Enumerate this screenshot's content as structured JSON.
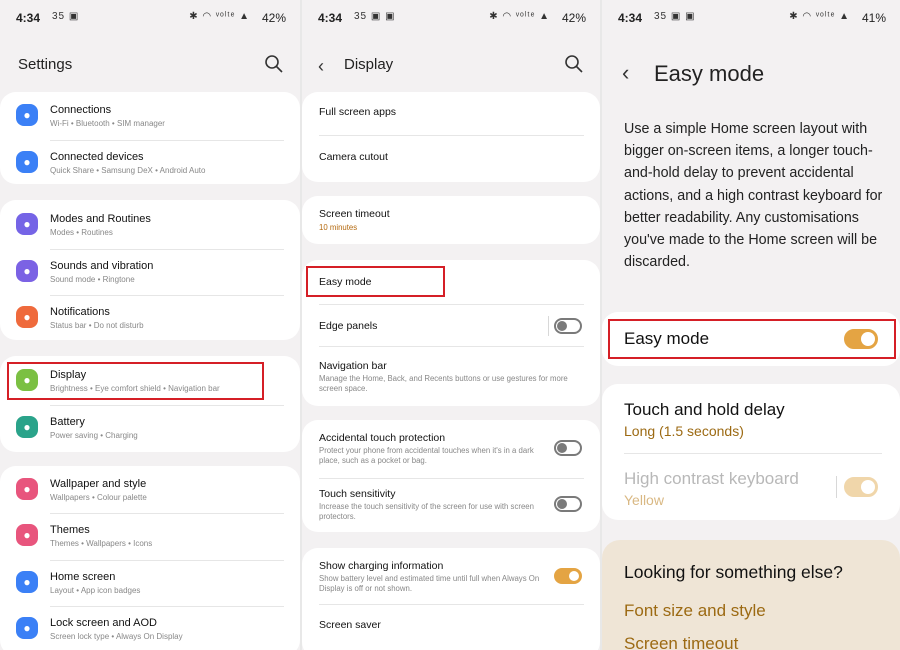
{
  "p1": {
    "status": {
      "time": "4:34",
      "icons_left": "35 ▣",
      "icons_right": "✱ ◠ ᵛᵒˡᵗᵉ ▲",
      "battery": "42%"
    },
    "title": "Settings",
    "items": [
      {
        "label": "Connections",
        "sub": "Wi-Fi • Bluetooth • SIM manager",
        "icon": "wifi-icon",
        "color": "#3b80f6"
      },
      {
        "label": "Connected devices",
        "sub": "Quick Share • Samsung DeX • Android Auto",
        "icon": "devices-icon",
        "color": "#3b80f6"
      },
      {
        "label": "Modes and Routines",
        "sub": "Modes • Routines",
        "icon": "modes-icon",
        "color": "#7564e6"
      },
      {
        "label": "Sounds and vibration",
        "sub": "Sound mode • Ringtone",
        "icon": "sound-icon",
        "color": "#7b62e4"
      },
      {
        "label": "Notifications",
        "sub": "Status bar • Do not disturb",
        "icon": "notifications-icon",
        "color": "#ef6a3c"
      },
      {
        "label": "Display",
        "sub": "Brightness • Eye comfort shield • Navigation bar",
        "icon": "display-icon",
        "color": "#7bc043"
      },
      {
        "label": "Battery",
        "sub": "Power saving • Charging",
        "icon": "battery-icon",
        "color": "#2aa38a"
      },
      {
        "label": "Wallpaper and style",
        "sub": "Wallpapers • Colour palette",
        "icon": "wallpaper-icon",
        "color": "#e8557d"
      },
      {
        "label": "Themes",
        "sub": "Themes • Wallpapers • Icons",
        "icon": "themes-icon",
        "color": "#e8557d"
      },
      {
        "label": "Home screen",
        "sub": "Layout • App icon badges",
        "icon": "home-icon",
        "color": "#3b80f6"
      },
      {
        "label": "Lock screen and AOD",
        "sub": "Screen lock type • Always On Display",
        "icon": "lock-icon",
        "color": "#3b80f6"
      }
    ]
  },
  "p2": {
    "status": {
      "time": "4:34",
      "icons_left": "35 ▣ ▣",
      "icons_right": "✱ ◠ ᵛᵒˡᵗᵉ ▲",
      "battery": "42%"
    },
    "title": "Display",
    "items": [
      {
        "label": "Full screen apps"
      },
      {
        "label": "Camera cutout"
      },
      {
        "label": "Screen timeout",
        "sub": "10 minutes"
      },
      {
        "label": "Easy mode"
      },
      {
        "label": "Edge panels"
      },
      {
        "label": "Navigation bar",
        "sub": "Manage the Home, Back, and Recents buttons or use gestures for more screen space."
      },
      {
        "label": "Accidental touch protection",
        "sub": "Protect your phone from accidental touches when it's in a dark place, such as a pocket or bag."
      },
      {
        "label": "Touch sensitivity",
        "sub": "Increase the touch sensitivity of the screen for use with screen protectors."
      },
      {
        "label": "Show charging information",
        "sub": "Show battery level and estimated time until full when Always On Display is off or not shown."
      },
      {
        "label": "Screen saver"
      }
    ]
  },
  "p3": {
    "status": {
      "time": "4:34",
      "icons_left": "35 ▣ ▣",
      "icons_right": "✱ ◠ ᵛᵒˡᵗᵉ ▲",
      "battery": "41%"
    },
    "title": "Easy mode",
    "description": "Use a simple Home screen layout with bigger on-screen items, a longer touch-and-hold delay to prevent accidental actions, and a high contrast keyboard for better readability. Any customisations you've made to the Home screen will be discarded.",
    "easy_mode_label": "Easy mode",
    "touch_hold_label": "Touch and hold delay",
    "touch_hold_value": "Long (1.5 seconds)",
    "keyboard_label": "High contrast keyboard",
    "keyboard_value": "Yellow",
    "looking_title": "Looking for something else?",
    "links": [
      "Font size and style",
      "Screen timeout"
    ]
  },
  "colors": {
    "accent": "#e4a443",
    "highlight": "#d51f26",
    "link": "#9c6a13"
  }
}
